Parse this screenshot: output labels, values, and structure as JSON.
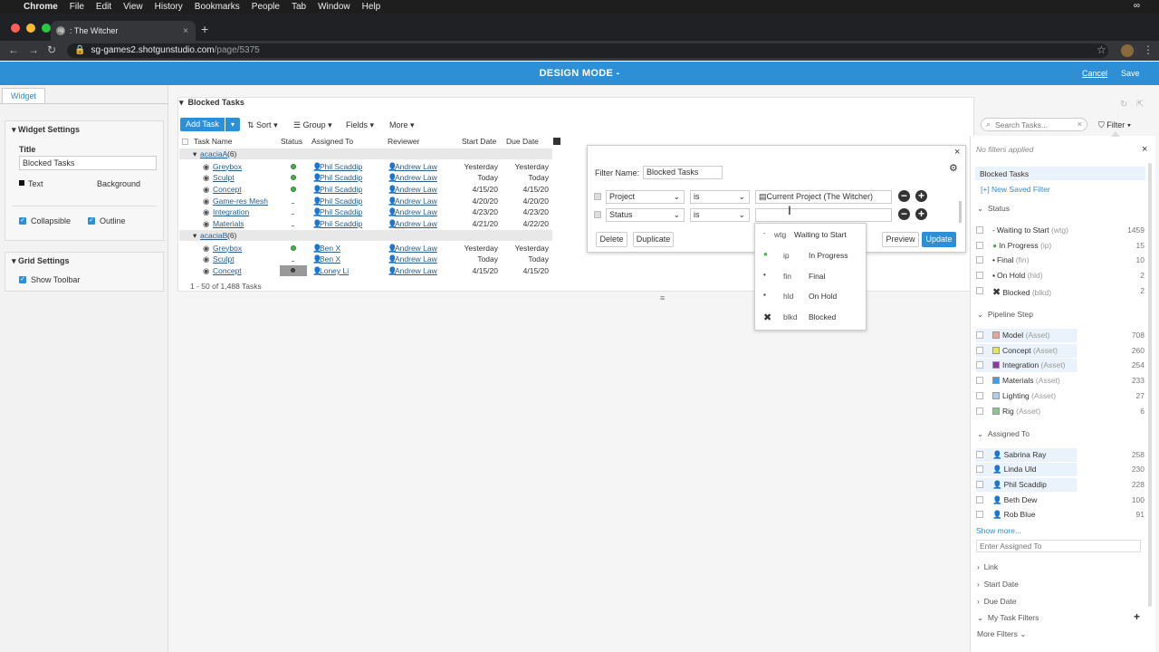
{
  "menubar": {
    "app": "Chrome",
    "items": [
      "File",
      "Edit",
      "View",
      "History",
      "Bookmarks",
      "People",
      "Tab",
      "Window",
      "Help"
    ]
  },
  "browser": {
    "tab_title": ": The Witcher",
    "url_host": "sg-games2.shotgunstudio.com",
    "url_path": "/page/5375"
  },
  "designbar": {
    "title": "DESIGN MODE -",
    "cancel": "Cancel",
    "save": "Save"
  },
  "left": {
    "tab": "Widget",
    "widget_settings": "Widget Settings",
    "title_label": "Title",
    "title_value": "Blocked Tasks",
    "text_label": "Text",
    "background_label": "Background",
    "collapsible_label": "Collapsible",
    "outline_label": "Outline",
    "grid_settings": "Grid Settings",
    "show_toolbar_label": "Show Toolbar"
  },
  "widget": {
    "title": "Blocked Tasks",
    "add_task": "Add Task",
    "sort": "Sort",
    "group": "Group",
    "fields": "Fields",
    "more": "More",
    "search_placeholder": "Search Tasks...",
    "filter": "Filter",
    "columns": [
      "Task Name",
      "Status",
      "Assigned To",
      "Reviewer",
      "Start Date",
      "Due Date"
    ],
    "groups": [
      {
        "name": "acaciaA",
        "count": "(6)",
        "rows": [
          {
            "task": "Greybox",
            "status": "ip",
            "assigned": "Phil Scaddip",
            "reviewer": "Andrew Law",
            "start": "Yesterday",
            "due": "Yesterday"
          },
          {
            "task": "Sculpt",
            "status": "ip",
            "assigned": "Phil Scaddip",
            "reviewer": "Andrew Law",
            "start": "Today",
            "due": "Today"
          },
          {
            "task": "Concept",
            "status": "ip",
            "assigned": "Phil Scaddip",
            "reviewer": "Andrew Law",
            "start": "4/15/20",
            "due": "4/15/20"
          },
          {
            "task": "Game-res Mesh",
            "status": "wtg",
            "assigned": "Phil Scaddip",
            "reviewer": "Andrew Law",
            "start": "4/20/20",
            "due": "4/20/20"
          },
          {
            "task": "Integration",
            "status": "wtg",
            "assigned": "Phil Scaddip",
            "reviewer": "Andrew Law",
            "start": "4/23/20",
            "due": "4/23/20"
          },
          {
            "task": "Materials",
            "status": "wtg",
            "assigned": "Phil Scaddip",
            "reviewer": "Andrew Law",
            "start": "4/21/20",
            "due": "4/22/20"
          }
        ]
      },
      {
        "name": "acaciaB",
        "count": "(6)",
        "rows": [
          {
            "task": "Greybox",
            "status": "ip",
            "assigned": "Ben X",
            "reviewer": "Andrew Law",
            "start": "Yesterday",
            "due": "Yesterday"
          },
          {
            "task": "Sculpt",
            "status": "wtg",
            "assigned": "Ben X",
            "reviewer": "Andrew Law",
            "start": "Today",
            "due": "Today"
          },
          {
            "task": "Concept",
            "status": "fin",
            "assigned": "Loney Li",
            "reviewer": "Andrew Law",
            "start": "4/15/20",
            "due": "4/15/20"
          }
        ]
      }
    ],
    "footer": "1 - 50 of 1,488 Tasks"
  },
  "dialog": {
    "filter_name_label": "Filter Name:",
    "filter_name_value": "Blocked Tasks",
    "row1_field": "Project",
    "row1_op": "is",
    "row1_value": "Current Project (The Witcher)",
    "row2_field": "Status",
    "row2_op": "is",
    "delete": "Delete",
    "duplicate": "Duplicate",
    "preview": "Preview",
    "update": "Update"
  },
  "dropdown": {
    "items": [
      {
        "code": "wtg",
        "label": "Waiting to Start"
      },
      {
        "code": "ip",
        "label": "In Progress"
      },
      {
        "code": "fin",
        "label": "Final"
      },
      {
        "code": "hld",
        "label": "On Hold"
      },
      {
        "code": "blkd",
        "label": "Blocked"
      }
    ]
  },
  "rpanel": {
    "no_filters": "No filters applied",
    "saved": "Blocked Tasks",
    "new_saved": "[+] New Saved Filter",
    "status_title": "Status",
    "status": [
      {
        "label": "Waiting to Start",
        "sub": "(wtg)",
        "count": "1459"
      },
      {
        "label": "In Progress",
        "sub": "(ip)",
        "count": "15"
      },
      {
        "label": "Final",
        "sub": "(fin)",
        "count": "10"
      },
      {
        "label": "On Hold",
        "sub": "(hld)",
        "count": "2"
      },
      {
        "label": "Blocked",
        "sub": "(blkd)",
        "count": "2"
      }
    ],
    "pipeline_title": "Pipeline Step",
    "pipeline": [
      {
        "label": "Model",
        "sub": "(Asset)",
        "count": "708",
        "color": "#e8a59a"
      },
      {
        "label": "Concept",
        "sub": "(Asset)",
        "count": "260",
        "color": "#e6e65c"
      },
      {
        "label": "Integration",
        "sub": "(Asset)",
        "count": "254",
        "color": "#8a3aa8"
      },
      {
        "label": "Materials",
        "sub": "(Asset)",
        "count": "233",
        "color": "#3aa0e8"
      },
      {
        "label": "Lighting",
        "sub": "(Asset)",
        "count": "27",
        "color": "#a8d0f0"
      },
      {
        "label": "Rig",
        "sub": "(Asset)",
        "count": "6",
        "color": "#8ac88a"
      }
    ],
    "assigned_title": "Assigned To",
    "assigned": [
      {
        "label": "Sabrina Ray",
        "count": "258"
      },
      {
        "label": "Linda Uld",
        "count": "230"
      },
      {
        "label": "Phil Scaddip",
        "count": "228"
      },
      {
        "label": "Beth Dew",
        "count": "100"
      },
      {
        "label": "Rob Blue",
        "count": "91"
      }
    ],
    "show_more": "Show more...",
    "enter_assigned_placeholder": "Enter Assigned To",
    "link": "Link",
    "start_date": "Start Date",
    "due_date": "Due Date",
    "my_task_filters": "My Task Filters",
    "more_filters": "More Filters"
  }
}
